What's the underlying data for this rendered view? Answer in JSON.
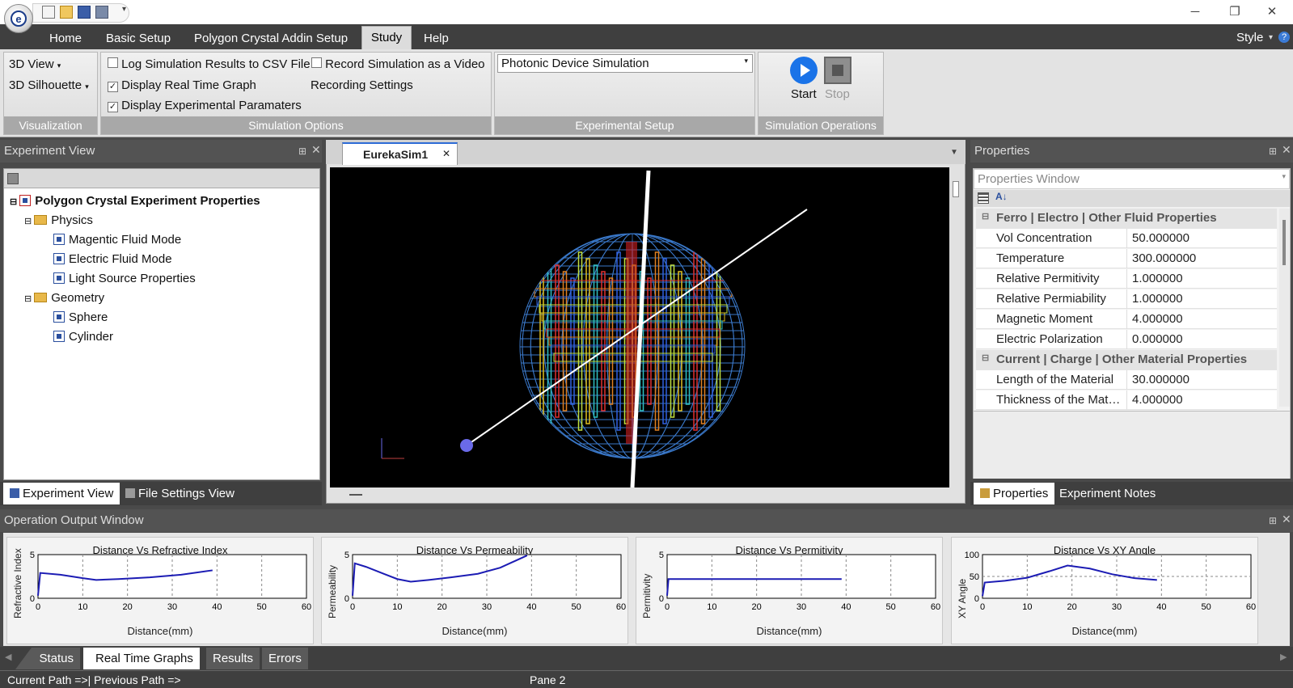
{
  "app": {
    "logo_letter": "e"
  },
  "menu": {
    "items": [
      "Home",
      "Basic Setup",
      "Polygon Crystal Addin Setup",
      "Study",
      "Help"
    ],
    "style_label": "Style"
  },
  "ribbon": {
    "visualization": {
      "view_dropdown": "3D View",
      "silhouette_dropdown": "3D Silhouette",
      "caption": "Visualization"
    },
    "simulation_options": {
      "log_csv": {
        "label": "Log Simulation Results to CSV File",
        "checked": false
      },
      "record_video": {
        "label": "Record Simulation as a Video",
        "checked": false
      },
      "real_time_graph": {
        "label": "Display Real Time Graph",
        "checked": true
      },
      "recording_settings": "Recording Settings",
      "experimental_params": {
        "label": "Display Experimental Paramaters",
        "checked": true
      },
      "caption": "Simulation Options"
    },
    "experimental_setup": {
      "selected": "Photonic Device Simulation",
      "caption": "Experimental Setup"
    },
    "simulation_operations": {
      "start": "Start",
      "stop": "Stop",
      "caption": "Simulation Operations"
    }
  },
  "experiment_view": {
    "title": "Experiment View",
    "root": "Polygon Crystal Experiment Properties",
    "physics": "Physics",
    "physics_items": [
      "Magentic Fluid Mode",
      "Electric Fluid Mode",
      "Light Source Properties"
    ],
    "geometry": "Geometry",
    "geometry_items": [
      "Sphere",
      "Cylinder"
    ],
    "tabs": [
      "Experiment View",
      "File Settings View"
    ]
  },
  "document": {
    "tab": "EurekaSim1"
  },
  "properties": {
    "title": "Properties",
    "selector": "Properties Window",
    "category1": "Ferro | Electro | Other Fluid Properties",
    "rows1": [
      {
        "name": "Vol Concentration",
        "value": "50.000000"
      },
      {
        "name": "Temperature",
        "value": "300.000000"
      },
      {
        "name": "Relative Permitivity",
        "value": "1.000000"
      },
      {
        "name": "Relative Permiability",
        "value": "1.000000"
      },
      {
        "name": "Magnetic Moment",
        "value": "4.000000"
      },
      {
        "name": "Electric Polarization",
        "value": "0.000000"
      }
    ],
    "category2": "Current | Charge | Other Material Properties",
    "rows2": [
      {
        "name": "Length of the Material",
        "value": "30.000000"
      },
      {
        "name": "Thickness of the Material",
        "value": "4.000000"
      }
    ],
    "tabs": [
      "Properties",
      "Experiment Notes"
    ]
  },
  "output": {
    "title": "Operation Output Window",
    "tabs": [
      "Status",
      "Real Time Graphs",
      "Results",
      "Errors"
    ]
  },
  "chart_data": [
    {
      "type": "line",
      "title": "Distance Vs Refractive Index",
      "xlabel": "Distance(mm)",
      "ylabel": "Refractive Index",
      "xlim": [
        0,
        60
      ],
      "ylim": [
        0,
        5
      ],
      "xticks": [
        0,
        10,
        20,
        30,
        40,
        50,
        60
      ],
      "yticks": [
        0,
        5
      ],
      "x": [
        0,
        0.5,
        5,
        10,
        13,
        18,
        25,
        32,
        39
      ],
      "y": [
        0.3,
        2.9,
        2.7,
        2.3,
        2.1,
        2.2,
        2.4,
        2.7,
        3.2
      ]
    },
    {
      "type": "line",
      "title": "Distance Vs Permeability",
      "xlabel": "Distance(mm)",
      "ylabel": "Permeability",
      "xlim": [
        0,
        60
      ],
      "ylim": [
        0,
        5
      ],
      "xticks": [
        0,
        10,
        20,
        30,
        40,
        50,
        60
      ],
      "yticks": [
        0,
        5
      ],
      "x": [
        0,
        0.5,
        3,
        7,
        10,
        13,
        17,
        22,
        28,
        33,
        39
      ],
      "y": [
        0.3,
        4.0,
        3.6,
        2.8,
        2.2,
        1.9,
        2.1,
        2.4,
        2.8,
        3.5,
        4.9
      ]
    },
    {
      "type": "line",
      "title": "Distance Vs Permitivity",
      "xlabel": "Distance(mm)",
      "ylabel": "Permitivity",
      "xlim": [
        0,
        60
      ],
      "ylim": [
        0,
        5
      ],
      "xticks": [
        0,
        10,
        20,
        30,
        40,
        50,
        60
      ],
      "yticks": [
        0,
        5
      ],
      "x": [
        0,
        0.3,
        5,
        15,
        25,
        39
      ],
      "y": [
        0.3,
        2.2,
        2.2,
        2.2,
        2.2,
        2.2
      ]
    },
    {
      "type": "line",
      "title": "Distance Vs XY Angle",
      "xlabel": "Distance(mm)",
      "ylabel": "XY Angle",
      "xlim": [
        0,
        60
      ],
      "ylim": [
        0,
        100
      ],
      "xticks": [
        0,
        10,
        20,
        30,
        40,
        50,
        60
      ],
      "yticks": [
        0,
        50,
        100
      ],
      "x": [
        0,
        0.5,
        5,
        10,
        15,
        19,
        24,
        29,
        34,
        39
      ],
      "y": [
        5,
        36,
        40,
        47,
        62,
        75,
        68,
        55,
        46,
        42
      ]
    }
  ],
  "statusbar": {
    "path": "Current Path =>| Previous Path =>",
    "pane": "Pane 2"
  },
  "colors": {
    "accent": "#1a73e8",
    "chart_line": "#1c1cb4",
    "ribbon_caption": "#a8a8a8"
  }
}
